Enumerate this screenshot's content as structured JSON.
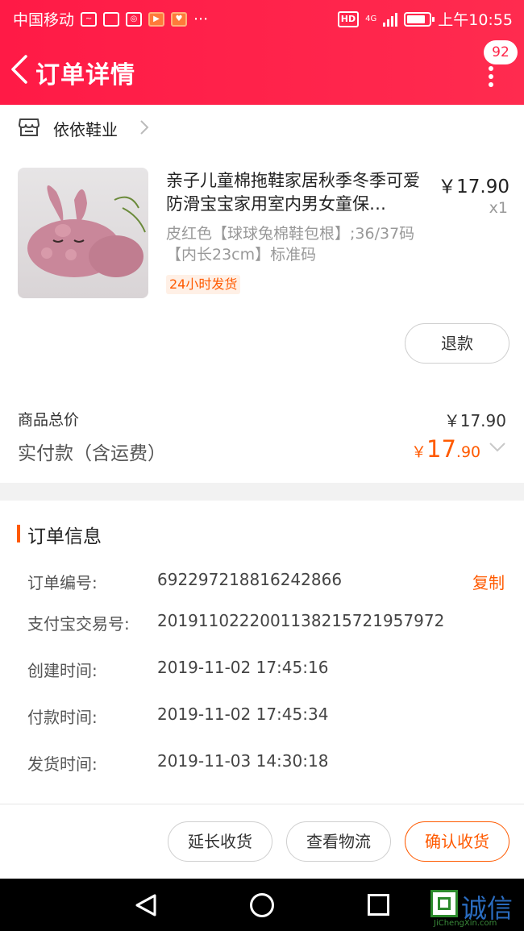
{
  "status_bar": {
    "carrier": "中国移动",
    "hd": "HD",
    "network": "4G",
    "time": "上午10:55"
  },
  "header": {
    "title": "订单详情",
    "badge": "92"
  },
  "store": {
    "name": "依依鞋业"
  },
  "product": {
    "title": "亲子儿童棉拖鞋家居秋季冬季可爱防滑宝宝家用室内男女童保…",
    "price": "￥17.90",
    "qty": "x1",
    "spec": "皮红色【球球兔棉鞋包根】;36/37码【内长23cm】标准码",
    "tag": "24小时发货",
    "refund_label": "退款"
  },
  "totals": {
    "goods_label": "商品总价",
    "goods_value": "￥17.90",
    "paid_label": "实付款（含运费）",
    "paid_currency": "￥",
    "paid_int": "17",
    "paid_dec": ".90"
  },
  "order_info": {
    "title": "订单信息",
    "copy_label": "复制",
    "rows": [
      {
        "key": "订单编号:",
        "value": "692297218816242866"
      },
      {
        "key": "支付宝交易号:",
        "value": "2019110222001138215721957972"
      },
      {
        "key": "创建时间:",
        "value": "2019-11-02 17:45:16"
      },
      {
        "key": "付款时间:",
        "value": "2019-11-02 17:45:34"
      },
      {
        "key": "发货时间:",
        "value": "2019-11-03 14:30:18"
      }
    ]
  },
  "actions": {
    "extend": "延长收货",
    "logistics": "查看物流",
    "confirm": "确认收货"
  },
  "watermark": {
    "text": "诚信",
    "sub": "JiChengXin.com"
  },
  "colors": {
    "header": "#ff1a46",
    "accent": "#ff5a00"
  }
}
